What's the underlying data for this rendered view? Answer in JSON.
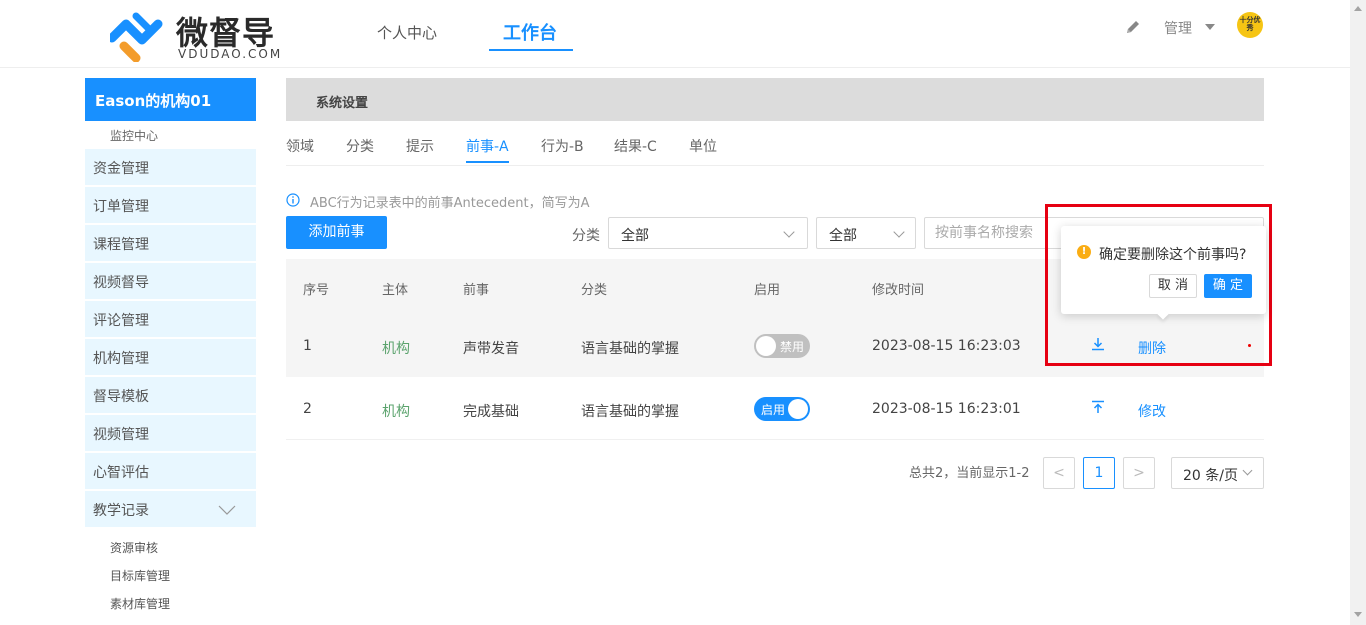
{
  "brand": {
    "name": "微督导",
    "sub": "VDUDAO.COM",
    "accent": "#1890ff",
    "badge": "十分优秀"
  },
  "nav": {
    "items": [
      "个人中心",
      "工作台"
    ],
    "active": "工作台",
    "admin_label": "管理"
  },
  "sidebar": {
    "org": "Eason的机构01",
    "monitor": "监控中心",
    "items": [
      "资金管理",
      "订单管理",
      "课程管理",
      "视频督导",
      "评论管理",
      "机构管理",
      "督导模板",
      "视频管理",
      "心智评估",
      "教学记录"
    ],
    "sub_items": [
      "资源审核",
      "目标库管理",
      "素材库管理"
    ]
  },
  "main": {
    "breadcrumb": "系统设置",
    "tabs": [
      "领域",
      "分类",
      "提示",
      "前事-A",
      "行为-B",
      "结果-C",
      "单位"
    ],
    "active_tab": "前事-A",
    "info": "ABC行为记录表中的前事Antecedent，简写为A",
    "add_button": "添加前事",
    "filter_label": "分类",
    "filter_category": "全部",
    "filter_status": "全部",
    "search_placeholder": "按前事名称搜索"
  },
  "table": {
    "headers": [
      "序号",
      "主体",
      "前事",
      "分类",
      "启用",
      "修改时间"
    ],
    "rows": [
      {
        "index": "1",
        "subject": "机构",
        "name": "声带发音",
        "category": "语言基础的掌握",
        "switch_text": "禁用",
        "enabled": false,
        "time": "2023-08-15 16:23:03",
        "action": "删除",
        "action_icon": "download-icon"
      },
      {
        "index": "2",
        "subject": "机构",
        "name": "完成基础",
        "category": "语言基础的掌握",
        "switch_text": "启用",
        "enabled": true,
        "time": "2023-08-15 16:23:01",
        "action": "修改",
        "action_icon": "upload-icon"
      }
    ]
  },
  "pagination": {
    "total_text": "总共2，当前显示1-2",
    "current": "1",
    "prev": "<",
    "next": ">",
    "page_size": "20 条/页"
  },
  "popconfirm": {
    "icon": "!",
    "text": "确定要删除这个前事吗?",
    "cancel": "取 消",
    "ok": "确 定"
  }
}
